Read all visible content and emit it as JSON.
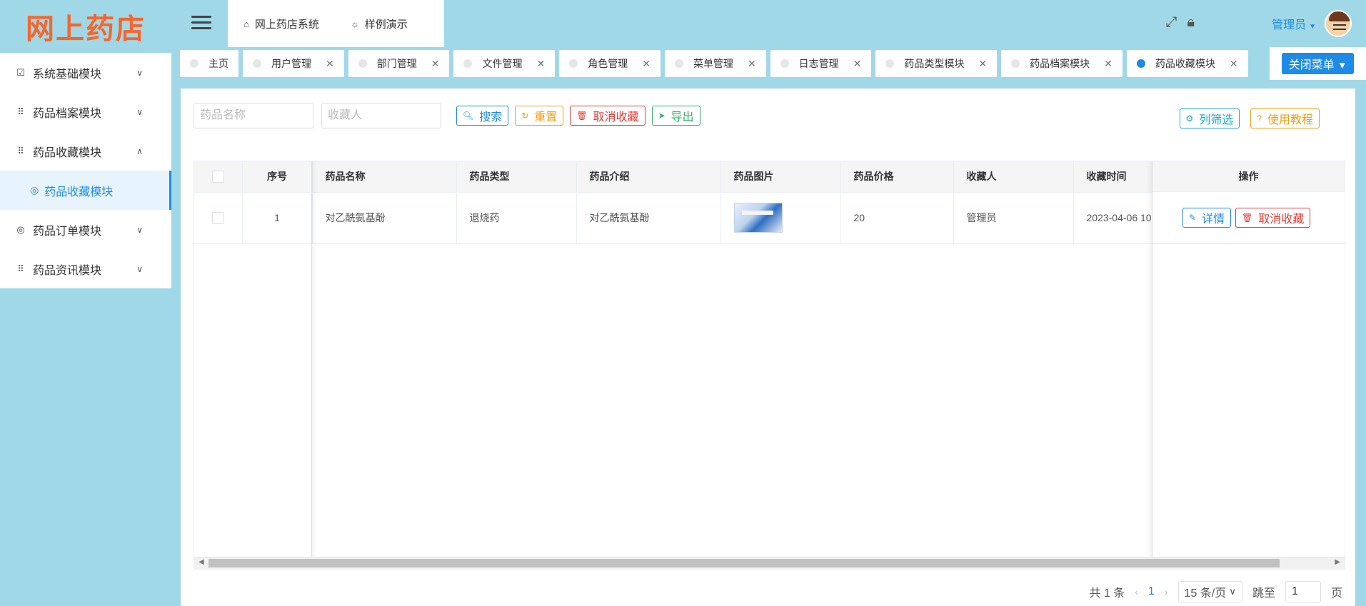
{
  "app": {
    "logo_text": "网上药店"
  },
  "sidebar": {
    "items": [
      {
        "icon": "chart-icon",
        "label": "系统基础模块",
        "chev": "∨"
      },
      {
        "icon": "grid-icon",
        "label": "药品档案模块",
        "chev": "∨"
      },
      {
        "icon": "grid-icon",
        "label": "药品收藏模块",
        "chev": "∧"
      },
      {
        "icon": "grid-icon",
        "label": "药品订单模块",
        "chev": "∨"
      },
      {
        "icon": "grid-icon",
        "label": "药品资讯模块",
        "chev": "∨"
      }
    ],
    "active_sub": "药品收藏模块"
  },
  "header": {
    "tabs": [
      {
        "icon": "home-icon",
        "label": "网上药店系统"
      },
      {
        "icon": "bulb-icon",
        "label": "样例演示"
      }
    ],
    "user": "管理员"
  },
  "tabbar": {
    "tags": [
      {
        "label": "主页",
        "closable": false
      },
      {
        "label": "用户管理",
        "closable": true
      },
      {
        "label": "部门管理",
        "closable": true
      },
      {
        "label": "文件管理",
        "closable": true
      },
      {
        "label": "角色管理",
        "closable": true
      },
      {
        "label": "菜单管理",
        "closable": true
      },
      {
        "label": "日志管理",
        "closable": true
      },
      {
        "label": "药品类型模块",
        "closable": true
      },
      {
        "label": "药品档案模块",
        "closable": true
      },
      {
        "label": "药品收藏模块",
        "closable": true,
        "active": true
      }
    ],
    "close_menu": "关闭菜单"
  },
  "search": {
    "name_placeholder": "药品名称",
    "collector_placeholder": "收藏人",
    "buttons": {
      "search": "搜索",
      "reset": "重置",
      "cancel_fav": "取消收藏",
      "export": "导出"
    },
    "filter": "列筛选",
    "tutorial": "使用教程"
  },
  "table": {
    "columns": [
      "序号",
      "药品名称",
      "药品类型",
      "药品介绍",
      "药品图片",
      "药品价格",
      "收藏人",
      "收藏时间",
      "操作"
    ],
    "rows": [
      {
        "index": "1",
        "name": "对乙酰氨基酚",
        "type": "退烧药",
        "intro": "对乙酰氨基酚",
        "price": "20",
        "collector": "管理员",
        "time": "2023-04-06 10"
      }
    ],
    "actions": {
      "detail": "详情",
      "cancel": "取消收藏"
    }
  },
  "pager": {
    "total": "共 1 条",
    "current": "1",
    "size": "15 条/页",
    "jump_label": "跳至",
    "jump_value": "1",
    "page_suffix": "页"
  },
  "colors": {
    "accent": "#1e8be6",
    "bg": "#a0d8e8",
    "logo": "#f5662c",
    "danger": "#e53935",
    "warn": "#f39c12",
    "success": "#2fb266"
  }
}
